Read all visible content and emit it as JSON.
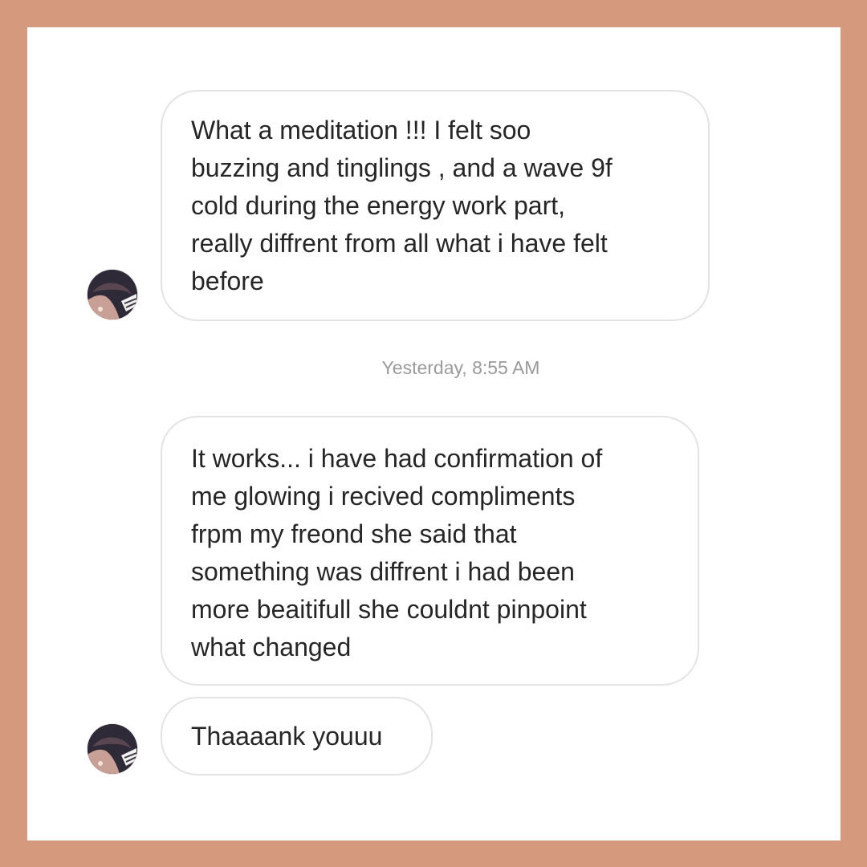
{
  "conversation": {
    "messages": [
      {
        "text": "What a meditation !!! I felt soo\nbuzzing and tinglings , and a wave 9f\ncold during the energy work part,\nreally diffrent from all what i have felt\nbefore"
      },
      {
        "text": "It works... i have had confirmation of\nme glowing i recived compliments\nfrpm my freond she said that\nsomething was diffrent i had been\nmore beaitifull she couldnt pinpoint\nwhat changed"
      },
      {
        "text": "Thaaaank youuu"
      }
    ],
    "timestamp": "Yesterday, 8:55 AM"
  },
  "avatar": {
    "icon": "profile-photo-icon"
  },
  "colors": {
    "border_frame": "#d59a7d",
    "background": "#ffffff",
    "bubble_border": "#e3e3e3",
    "message_text": "#262626",
    "timestamp_text": "#9a9a9a"
  }
}
